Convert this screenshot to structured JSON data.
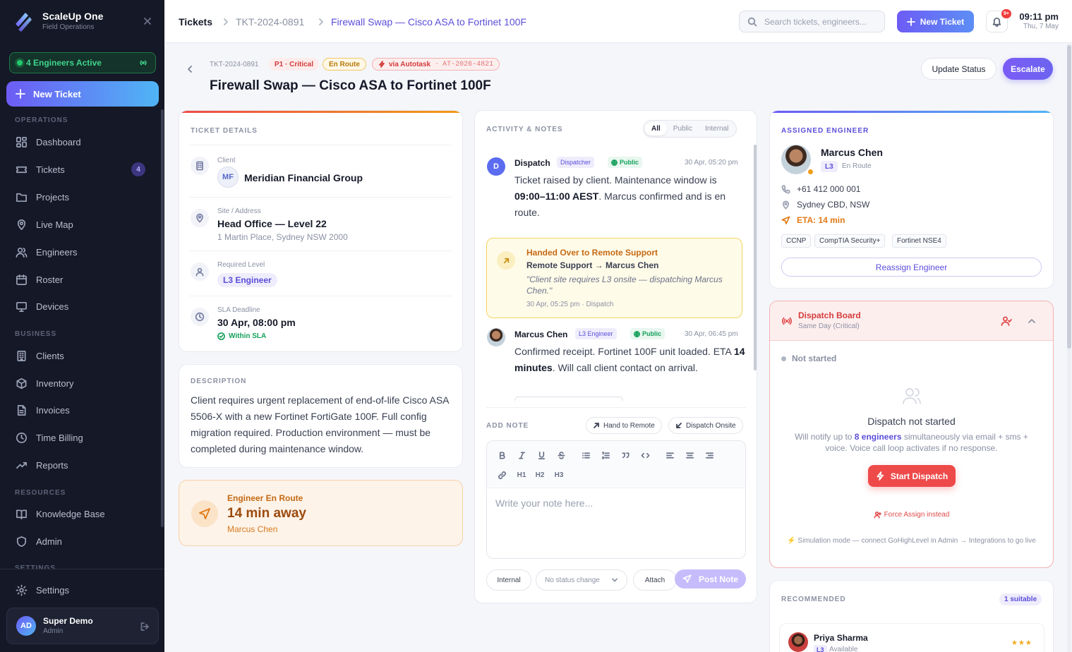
{
  "sidebar": {
    "brand_name": "ScaleUp One",
    "brand_sub": "Field Operations",
    "engineers_active": "4 Engineers Active",
    "new_ticket": "New Ticket",
    "sections": {
      "operations": "OPERATIONS",
      "business": "BUSINESS",
      "resources": "RESOURCES",
      "settings": "SETTINGS"
    },
    "items": [
      {
        "label": "Dashboard",
        "icon": "grid-icon"
      },
      {
        "label": "Tickets",
        "icon": "ticket-icon",
        "badge": "4"
      },
      {
        "label": "Projects",
        "icon": "folder-icon"
      },
      {
        "label": "Live Map",
        "icon": "map-pin-icon"
      },
      {
        "label": "Engineers",
        "icon": "users-icon"
      },
      {
        "label": "Roster",
        "icon": "calendar-icon"
      },
      {
        "label": "Devices",
        "icon": "monitor-icon"
      },
      {
        "label": "Clients",
        "icon": "building-icon"
      },
      {
        "label": "Inventory",
        "icon": "box-icon"
      },
      {
        "label": "Invoices",
        "icon": "file-icon"
      },
      {
        "label": "Time Billing",
        "icon": "clock-icon"
      },
      {
        "label": "Reports",
        "icon": "trending-icon"
      },
      {
        "label": "Knowledge Base",
        "icon": "book-icon"
      },
      {
        "label": "Admin",
        "icon": "shield-icon"
      }
    ],
    "settings": "Settings",
    "user": {
      "initials": "AD",
      "name": "Super Demo",
      "role": "Admin"
    }
  },
  "topbar": {
    "breadcrumb": [
      "Tickets",
      "TKT-2024-0891",
      "Firewall Swap — Cisco ASA to Fortinet 100F"
    ],
    "search_placeholder": "Search tickets, engineers...",
    "new_ticket": "New Ticket",
    "notif_badge": "9+",
    "time": "09:11 pm",
    "date": "Thu, 7 May"
  },
  "header": {
    "ticket_id": "TKT-2024-0891",
    "priority": "P1 · Critical",
    "status": "En Route",
    "source": "via Autotask",
    "source_ref": "AT-2026-4821",
    "title": "Firewall Swap — Cisco ASA to Fortinet 100F",
    "update_status": "Update Status",
    "escalate": "Escalate"
  },
  "details": {
    "label": "TICKET DETAILS",
    "client_label": "Client",
    "client_initials": "MF",
    "client": "Meridian Financial Group",
    "site_label": "Site / Address",
    "site": "Head Office — Level 22",
    "address": "1 Martin Place, Sydney NSW 2000",
    "level_label": "Required Level",
    "level": "L3 Engineer",
    "sla_label": "SLA Deadline",
    "sla": "30 Apr, 08:00 pm",
    "sla_status": "Within SLA"
  },
  "description": {
    "label": "DESCRIPTION",
    "text": "Client requires urgent replacement of end-of-life Cisco ASA 5506-X with a new Fortinet FortiGate 100F. Full config migration required. Production environment — must be completed during maintenance window."
  },
  "enroute": {
    "label": "Engineer En Route",
    "eta": "14 min away",
    "engineer": "Marcus Chen"
  },
  "activity": {
    "label": "ACTIVITY & NOTES",
    "filters": [
      "All",
      "Public",
      "Internal"
    ],
    "entries": [
      {
        "initial": "D",
        "name": "Dispatch",
        "role": "Dispatcher",
        "visibility": "Public",
        "time": "30 Apr, 05:20 pm",
        "t1": "Ticket raised by client. Maintenance window is ",
        "b1": "09:00–11:00 AEST",
        "t2": ". Marcus confirmed and is en route."
      },
      {
        "name": "Marcus Chen",
        "role": "L3 Engineer",
        "visibility": "Public",
        "time": "30 Apr, 06:45 pm",
        "t1": "Confirmed receipt. Fortinet 100F unit loaded. ETA ",
        "b1": "14 minutes",
        "t2": ". Will call client contact on arrival."
      }
    ],
    "handover": {
      "title": "Handed Over to Remote Support",
      "route": "Remote Support → Marcus Chen",
      "quote": "\"Client site requires L3 onsite — dispatching Marcus Chen.\"",
      "meta": "30 Apr, 05:25 pm · Dispatch"
    }
  },
  "note": {
    "label": "ADD NOTE",
    "hand_remote": "Hand to Remote",
    "dispatch_onsite": "Dispatch Onsite",
    "toolbar": [
      "bold-icon",
      "italic-icon",
      "underline-icon",
      "strike-icon",
      "bullet-list-icon",
      "numbered-list-icon",
      "quote-icon",
      "code-icon",
      "align-left-icon",
      "align-center-icon",
      "align-right-icon",
      "link-icon"
    ],
    "headings": [
      "H1",
      "H2",
      "H3"
    ],
    "placeholder": "Write your note here...",
    "internal": "Internal",
    "status_select": "No status change",
    "attach": "Attach",
    "post": "Post Note"
  },
  "engineer": {
    "label": "ASSIGNED ENGINEER",
    "name": "Marcus Chen",
    "level": "L3",
    "status": "En Route",
    "phone": "+61 412 000 001",
    "location": "Sydney CBD, NSW",
    "eta": "ETA: 14 min",
    "certs": [
      "CCNP",
      "CompTIA Security+",
      "Fortinet NSE4"
    ],
    "reassign": "Reassign Engineer"
  },
  "dispatch": {
    "title": "Dispatch Board",
    "subtitle": "Same Day (Critical)",
    "state": "Not started",
    "heading": "Dispatch not started",
    "desc_a": "Will notify up to ",
    "desc_b": "8 engineers",
    "desc_c": " simultaneously via email + sms + voice. Voice call loop activates if no response.",
    "start": "Start Dispatch",
    "force": "Force Assign instead",
    "sim": "Simulation mode — connect GoHighLevel in Admin → Integrations to go live"
  },
  "recommended": {
    "label": "RECOMMENDED",
    "count": "1 suitable",
    "name": "Priya Sharma",
    "level": "L3",
    "status": "Available",
    "rating": 3
  },
  "colors": {
    "accent": "#6d5cf5",
    "critical": "#d43b3b",
    "warning": "#e27a15",
    "success": "#14a05b"
  }
}
